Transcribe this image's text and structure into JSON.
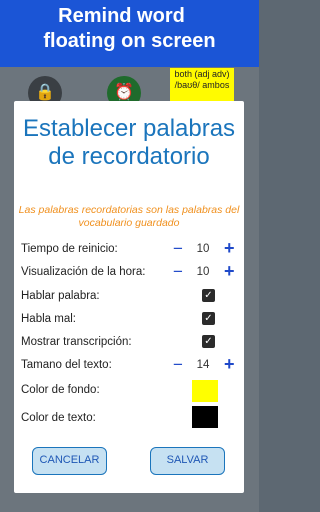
{
  "banner": {
    "line1": "Remind word",
    "line2": "floating on  screen"
  },
  "note": {
    "text": "both (adj adv) /baʊθ/ ambos"
  },
  "icons": {
    "lock": "lock-icon",
    "alarm": "alarm-clock-icon"
  },
  "dialog": {
    "title": "Establecer palabras de recordatorio",
    "subtitle": "Las palabras recordatorias son las palabras del vocabulario guardado",
    "rows": [
      {
        "label": "Tiempo de reinicio:",
        "value": "10"
      },
      {
        "label": "Visualización de la hora:",
        "value": "10"
      },
      {
        "label": "Hablar palabra:",
        "checked": true
      },
      {
        "label": "Habla mal:",
        "checked": true
      },
      {
        "label": "Mostrar transcripción:",
        "checked": true
      },
      {
        "label": "Tamano del texto:",
        "value": "14"
      },
      {
        "label": "Color de fondo:",
        "color": "#ffff00"
      },
      {
        "label": "Color de texto:",
        "color": "#000000"
      }
    ],
    "controls": {
      "minus": "−",
      "plus": "+",
      "check": "✓"
    },
    "cancel_label": "CANCELAR",
    "save_label": "SALVAR"
  },
  "colors": {
    "banner": "#1b55d6",
    "accent": "#1b75bc",
    "subtitle": "#f0901e",
    "note": "#fffb00"
  }
}
